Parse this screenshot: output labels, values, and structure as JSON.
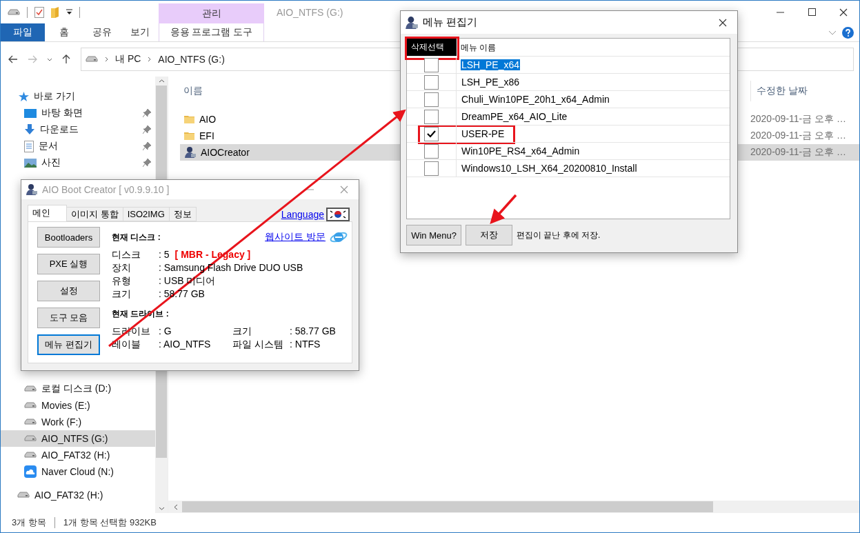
{
  "explorer": {
    "title": "AIO_NTFS (G:)",
    "context_group": "관리",
    "ribbon_tabs": [
      {
        "label": "파일",
        "kind": "file"
      },
      {
        "label": "홈",
        "kind": "tab"
      },
      {
        "label": "공유",
        "kind": "tab"
      },
      {
        "label": "보기",
        "kind": "tab"
      },
      {
        "label": "응용 프로그램 도구",
        "kind": "context"
      }
    ],
    "breadcrumb": [
      "내 PC",
      "AIO_NTFS (G:)"
    ],
    "sidebar": {
      "quick_access": {
        "label": "바로 가기",
        "children": [
          {
            "label": "바탕 화면",
            "kind": "desktop",
            "pinned": true
          },
          {
            "label": "다운로드",
            "kind": "download",
            "pinned": true
          },
          {
            "label": "문서",
            "kind": "document",
            "pinned": true
          },
          {
            "label": "사진",
            "kind": "pictures",
            "pinned": true
          }
        ]
      },
      "drives": [
        {
          "label": "로컬 디스크 (D:)",
          "kind": "drive",
          "selected": false
        },
        {
          "label": "Movies (E:)",
          "kind": "drive",
          "selected": false
        },
        {
          "label": "Work (F:)",
          "kind": "drive",
          "selected": false
        },
        {
          "label": "AIO_NTFS (G:)",
          "kind": "drive",
          "selected": true
        },
        {
          "label": "AIO_FAT32 (H:)",
          "kind": "drive",
          "selected": false
        },
        {
          "label": "Naver Cloud (N:)",
          "kind": "cloud",
          "selected": false
        }
      ],
      "top_level": [
        {
          "label": "AIO_FAT32 (H:)",
          "kind": "drive",
          "selected": false
        }
      ]
    },
    "columns": [
      "이름",
      "수정한 날짜"
    ],
    "files": [
      {
        "name": "AIO",
        "kind": "folder",
        "date": "2020-09-11-금 오후 …",
        "selected": false
      },
      {
        "name": "EFI",
        "kind": "folder",
        "date": "2020-09-11-금 오후 …",
        "selected": false
      },
      {
        "name": "AIOCreator",
        "kind": "app",
        "date": "2020-09-11-금 오후 …",
        "selected": true
      }
    ],
    "status_bar": [
      "3개 항목",
      "1개 항목 선택함 932KB"
    ]
  },
  "boot_creator": {
    "title": "AIO Boot Creator [ v0.9.9.10 ]",
    "tabs": [
      {
        "label": "메인",
        "selected": true
      },
      {
        "label": "이미지 통합",
        "selected": false
      },
      {
        "label": "ISO2IMG",
        "selected": false
      },
      {
        "label": "정보",
        "selected": false
      }
    ],
    "language_link": "Language",
    "website_link": "웹사이트 방문",
    "buttons": [
      {
        "label": "Bootloaders",
        "focused": false
      },
      {
        "label": "PXE 실행",
        "focused": false
      },
      {
        "label": "설정",
        "focused": false
      },
      {
        "label": "도구 모음",
        "focused": false
      },
      {
        "label": "메뉴 편집기",
        "focused": true
      }
    ],
    "disk_heading": "현재 디스크 :",
    "disk_rows": [
      {
        "label": "디스크",
        "value": ": 5",
        "badge": "[ MBR - Legacy ]"
      },
      {
        "label": "장치",
        "value": ": Samsung Flash Drive DUO USB"
      },
      {
        "label": "유형",
        "value": ": USB 미디어"
      },
      {
        "label": "크기",
        "value": ": 58.77 GB"
      }
    ],
    "drive_heading": "현재 드라이브 :",
    "drive_rows": [
      {
        "label": "드라이브",
        "value": ": G"
      },
      {
        "label": "크기",
        "value": ": 58.77 GB"
      },
      {
        "label": "레이블",
        "value": ": AIO_NTFS"
      },
      {
        "label": "파일 시스템",
        "value": ": NTFS"
      }
    ]
  },
  "menu_editor": {
    "title": "메뉴 편집기",
    "columns": [
      "삭제선택",
      "메뉴 이름"
    ],
    "items": [
      {
        "name": "LSH_PE_x64",
        "checked": false,
        "selected": true
      },
      {
        "name": "LSH_PE_x86",
        "checked": false,
        "selected": false
      },
      {
        "name": "Chuli_Win10PE_20h1_x64_Admin",
        "checked": false,
        "selected": false
      },
      {
        "name": "DreamPE_x64_AIO_Lite",
        "checked": false,
        "selected": false
      },
      {
        "name": "USER-PE",
        "checked": true,
        "selected": false
      },
      {
        "name": "Win10PE_RS4_x64_Admin",
        "checked": false,
        "selected": false
      },
      {
        "name": "Windows10_LSH_X64_20200810_Install",
        "checked": false,
        "selected": false
      }
    ],
    "buttons": [
      "Win Menu?",
      "저장"
    ],
    "note": "편집이 끝난 후에 저장."
  }
}
